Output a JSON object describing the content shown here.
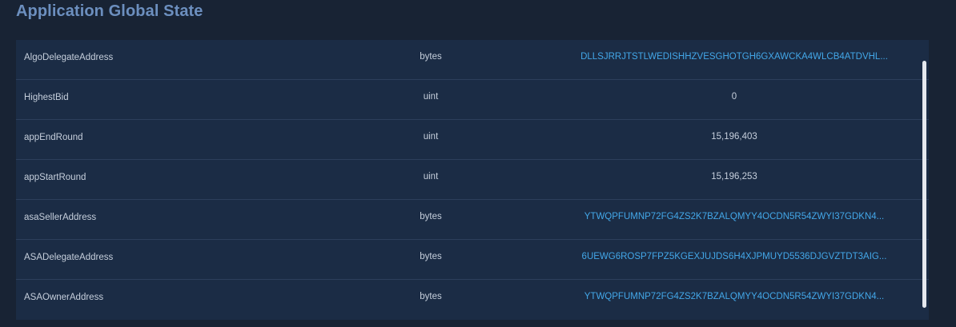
{
  "section": {
    "title": "Application Global State"
  },
  "table": {
    "rows": [
      {
        "key": "AlgoDelegateAddress",
        "type": "bytes",
        "value": "DLLSJRRJTSTLWEDISHHZVESGHOTGH6GXAWCKA4WLCB4ATDVHL...",
        "is_link": true
      },
      {
        "key": "HighestBid",
        "type": "uint",
        "value": "0",
        "is_link": false
      },
      {
        "key": "appEndRound",
        "type": "uint",
        "value": "15,196,403",
        "is_link": false
      },
      {
        "key": "appStartRound",
        "type": "uint",
        "value": "15,196,253",
        "is_link": false
      },
      {
        "key": "asaSellerAddress",
        "type": "bytes",
        "value": "YTWQPFUMNP72FG4ZS2K7BZALQMYY4OCDN5R54ZWYI37GDKN4...",
        "is_link": true
      },
      {
        "key": "ASADelegateAddress",
        "type": "bytes",
        "value": "6UEWG6ROSP7FPZ5KGEXJUJDS6H4XJPMUYD5536DJGVZTDT3AIG...",
        "is_link": true
      },
      {
        "key": "ASAOwnerAddress",
        "type": "bytes",
        "value": "YTWQPFUMNP72FG4ZS2K7BZALQMYY4OCDN5R54ZWYI37GDKN4...",
        "is_link": true
      }
    ]
  },
  "colors": {
    "background": "#182334",
    "card": "#1b2c45",
    "title": "#6c8fbf",
    "link": "#43a7e8",
    "text": "#c6cfdc"
  }
}
